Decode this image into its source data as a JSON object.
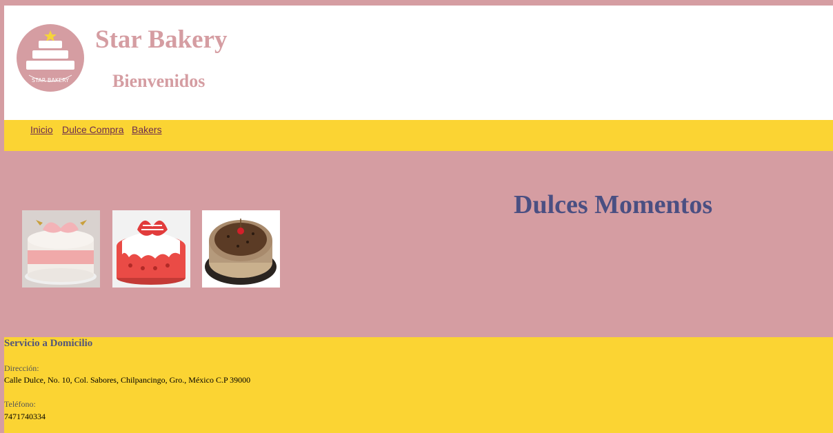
{
  "header": {
    "site_title": "Star Bakery",
    "welcome": "Bienvenidos",
    "logo_text": "STAR BAKERY"
  },
  "nav": {
    "items": [
      {
        "label": "Inicio"
      },
      {
        "label": "Dulce Compra"
      },
      {
        "label": "Bakers"
      }
    ]
  },
  "main": {
    "headline": "Dulces Momentos",
    "images": [
      {
        "name": "pink-rose-cake-image"
      },
      {
        "name": "red-bow-cake-image"
      },
      {
        "name": "chocolate-cake-image"
      }
    ]
  },
  "footer": {
    "title": "Servicio a Domicilio",
    "address_label": "Dirección:",
    "address": "Calle Dulce, No. 10, Col. Sabores, Chilpancingo, Gro., México C.P 39000",
    "phone_label": "Teléfono:",
    "phone": "7471740334"
  },
  "colors": {
    "pink": "#d59da2",
    "yellow": "#fbd433",
    "headline": "#4a4f82",
    "link": "#6b2b4e"
  }
}
